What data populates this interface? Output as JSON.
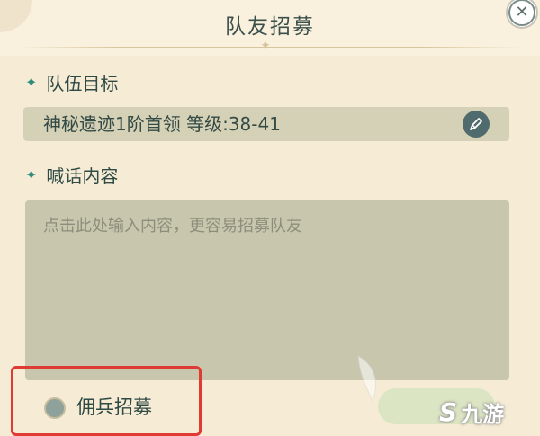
{
  "dialog": {
    "title": "队友招募",
    "close_icon": "close-icon"
  },
  "team_target": {
    "section_label": "队伍目标",
    "value": "神秘遗迹1阶首领 等级:38-41",
    "edit_icon": "pen-edit-icon"
  },
  "shout": {
    "section_label": "喊话内容",
    "placeholder": "点击此处输入内容，更容易招募队友"
  },
  "mercenary": {
    "label": "佣兵招募",
    "checked": false
  },
  "watermark": {
    "logo": "S",
    "text": "九游"
  },
  "colors": {
    "background": "#f6ecd6",
    "accent": "#2f8c7d",
    "highlight_box": "#e03a35",
    "input_bg": "#c8c6ad"
  }
}
